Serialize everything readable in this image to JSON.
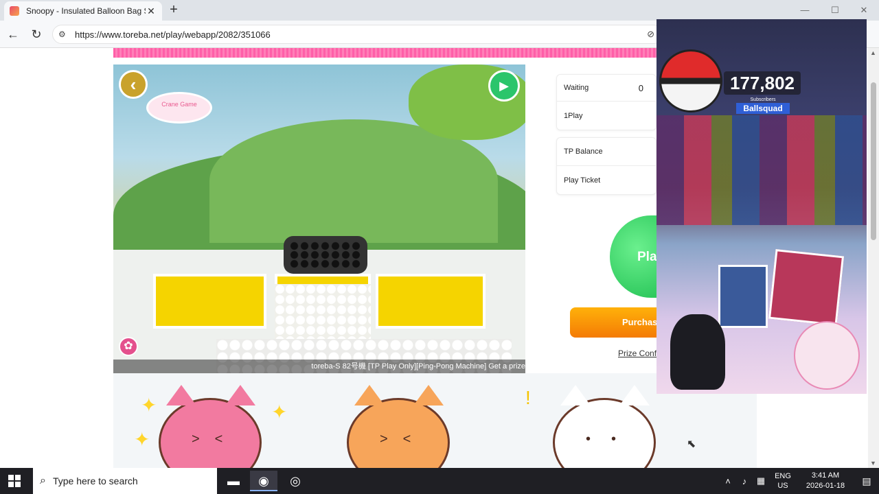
{
  "browser": {
    "tab_title": "Snoopy - Insulated Balloon Bag S",
    "tab_close": "✕",
    "new_tab": "+",
    "url": "https://www.toreba.net/play/webapp/2082/351066",
    "window_controls": {
      "minimize": "—",
      "maximize": "☐",
      "close": "✕"
    }
  },
  "machine": {
    "logo_text": "Crane Game",
    "caption": "toreba-S 82号機 [TP Play Only][Ping-Pong Machine] Get a prize"
  },
  "panel": {
    "waiting_label": "Waiting",
    "waiting_value": "0",
    "play_label": "1Play",
    "tp_balance_label": "TP Balance",
    "play_ticket_label": "Play Ticket",
    "play_button": "Pla",
    "purchase_button": "Purchas",
    "prize_link": "Prize Confi"
  },
  "overlay": {
    "subscriber_count": "177,802",
    "subscriber_label": "Subscribers",
    "channel_name": "Ballsquad"
  },
  "taskbar": {
    "search_placeholder": "Type here to search",
    "lang_primary": "ENG",
    "lang_secondary": "US",
    "time": "3:41 AM",
    "date": "2026-01-18"
  },
  "colors": {
    "accent_pink": "#ff5fa8",
    "play_green": "#1fbf51",
    "purchase_orange": "#f47b05",
    "channel_blue": "#2f5fd6"
  },
  "icons": {
    "back": "chevron-left-icon",
    "reload": "reload-icon",
    "camera": "video-camera-icon",
    "settings": "gear-icon"
  }
}
